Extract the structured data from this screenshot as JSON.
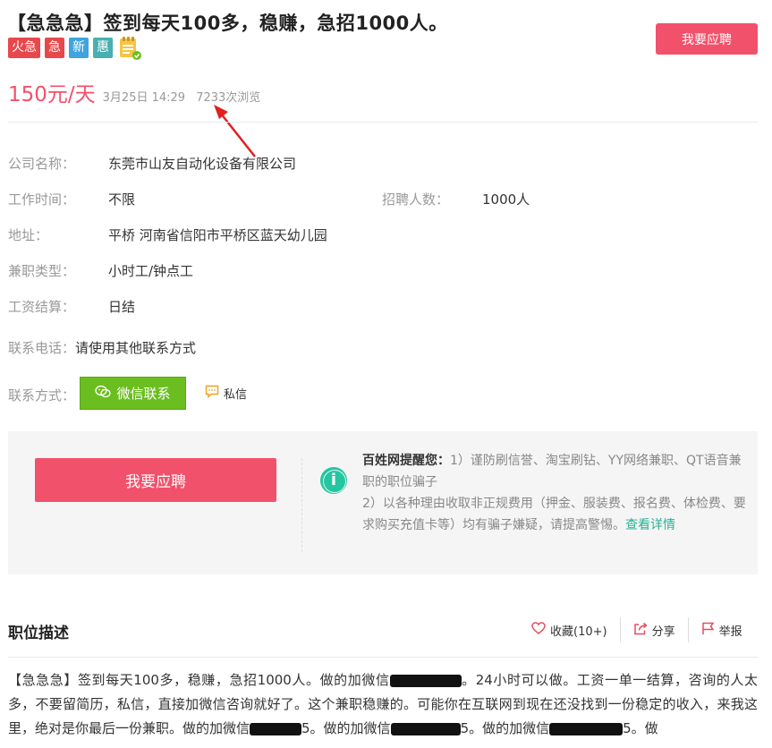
{
  "header": {
    "title": "【急急急】签到每天100多，稳赚，急招1000人。",
    "tags": [
      {
        "label": "火急",
        "color": "#e8484b"
      },
      {
        "label": "急",
        "color": "#e8484b"
      },
      {
        "label": "新",
        "color": "#3fa3dd"
      },
      {
        "label": "惠",
        "color": "#48b0b0"
      }
    ],
    "apply_label": "我要应聘",
    "price": "150元/天",
    "date": "3月25日 14:29",
    "views": "7233次浏览"
  },
  "info": {
    "company_label": "公司名称：",
    "company": "东莞市山友自动化设备有限公司",
    "worktime_label": "工作时间：",
    "worktime": "不限",
    "headcount_label": "招聘人数：",
    "headcount": "1000人",
    "address_label": "地址：",
    "address": "平桥 河南省信阳市平桥区蓝天幼儿园",
    "jobtype_label": "兼职类型：",
    "jobtype": "小时工/钟点工",
    "settle_label": "工资结算：",
    "settle": "日结",
    "phone_label": "联系电话：",
    "phone": "请使用其他联系方式",
    "contact_label": "联系方式：",
    "wechat_label": "微信联系",
    "pm_label": "私信"
  },
  "notice": {
    "apply_label": "我要应聘",
    "brand": "百姓网提醒您：",
    "line1": "1）谨防刷信誉、淘宝刷钻、YY网络兼职、QT语音兼职的职位骗子",
    "line2": "2）以各种理由收取非正规费用（押金、服装费、报名费、体检费、要求购买充值卡等）均有骗子嫌疑，请提高警惕。",
    "more_link": "查看详情"
  },
  "description": {
    "title": "职位描述",
    "favorite_label": "收藏(10+)",
    "share_label": "分享",
    "report_label": "举报",
    "seg1": "【急急急】签到每天100多，稳赚，急招1000人。做的加微信",
    "seg2": "。24小时可以做。工资一单一结算，咨询的人太多，不要留简历，私信，直接加微信咨询就好了。这个兼职稳赚的。可能你在互联网到现在还没找到一份稳定的收入，来我这里，绝对是你最后一份兼职。做的加微信",
    "seg3": "5。做的加微信",
    "seg4": "5。做的加微信",
    "seg5": "5。做"
  },
  "colors": {
    "accent": "#f2516b",
    "wechat": "#6bbe1f",
    "link": "#24b396"
  }
}
